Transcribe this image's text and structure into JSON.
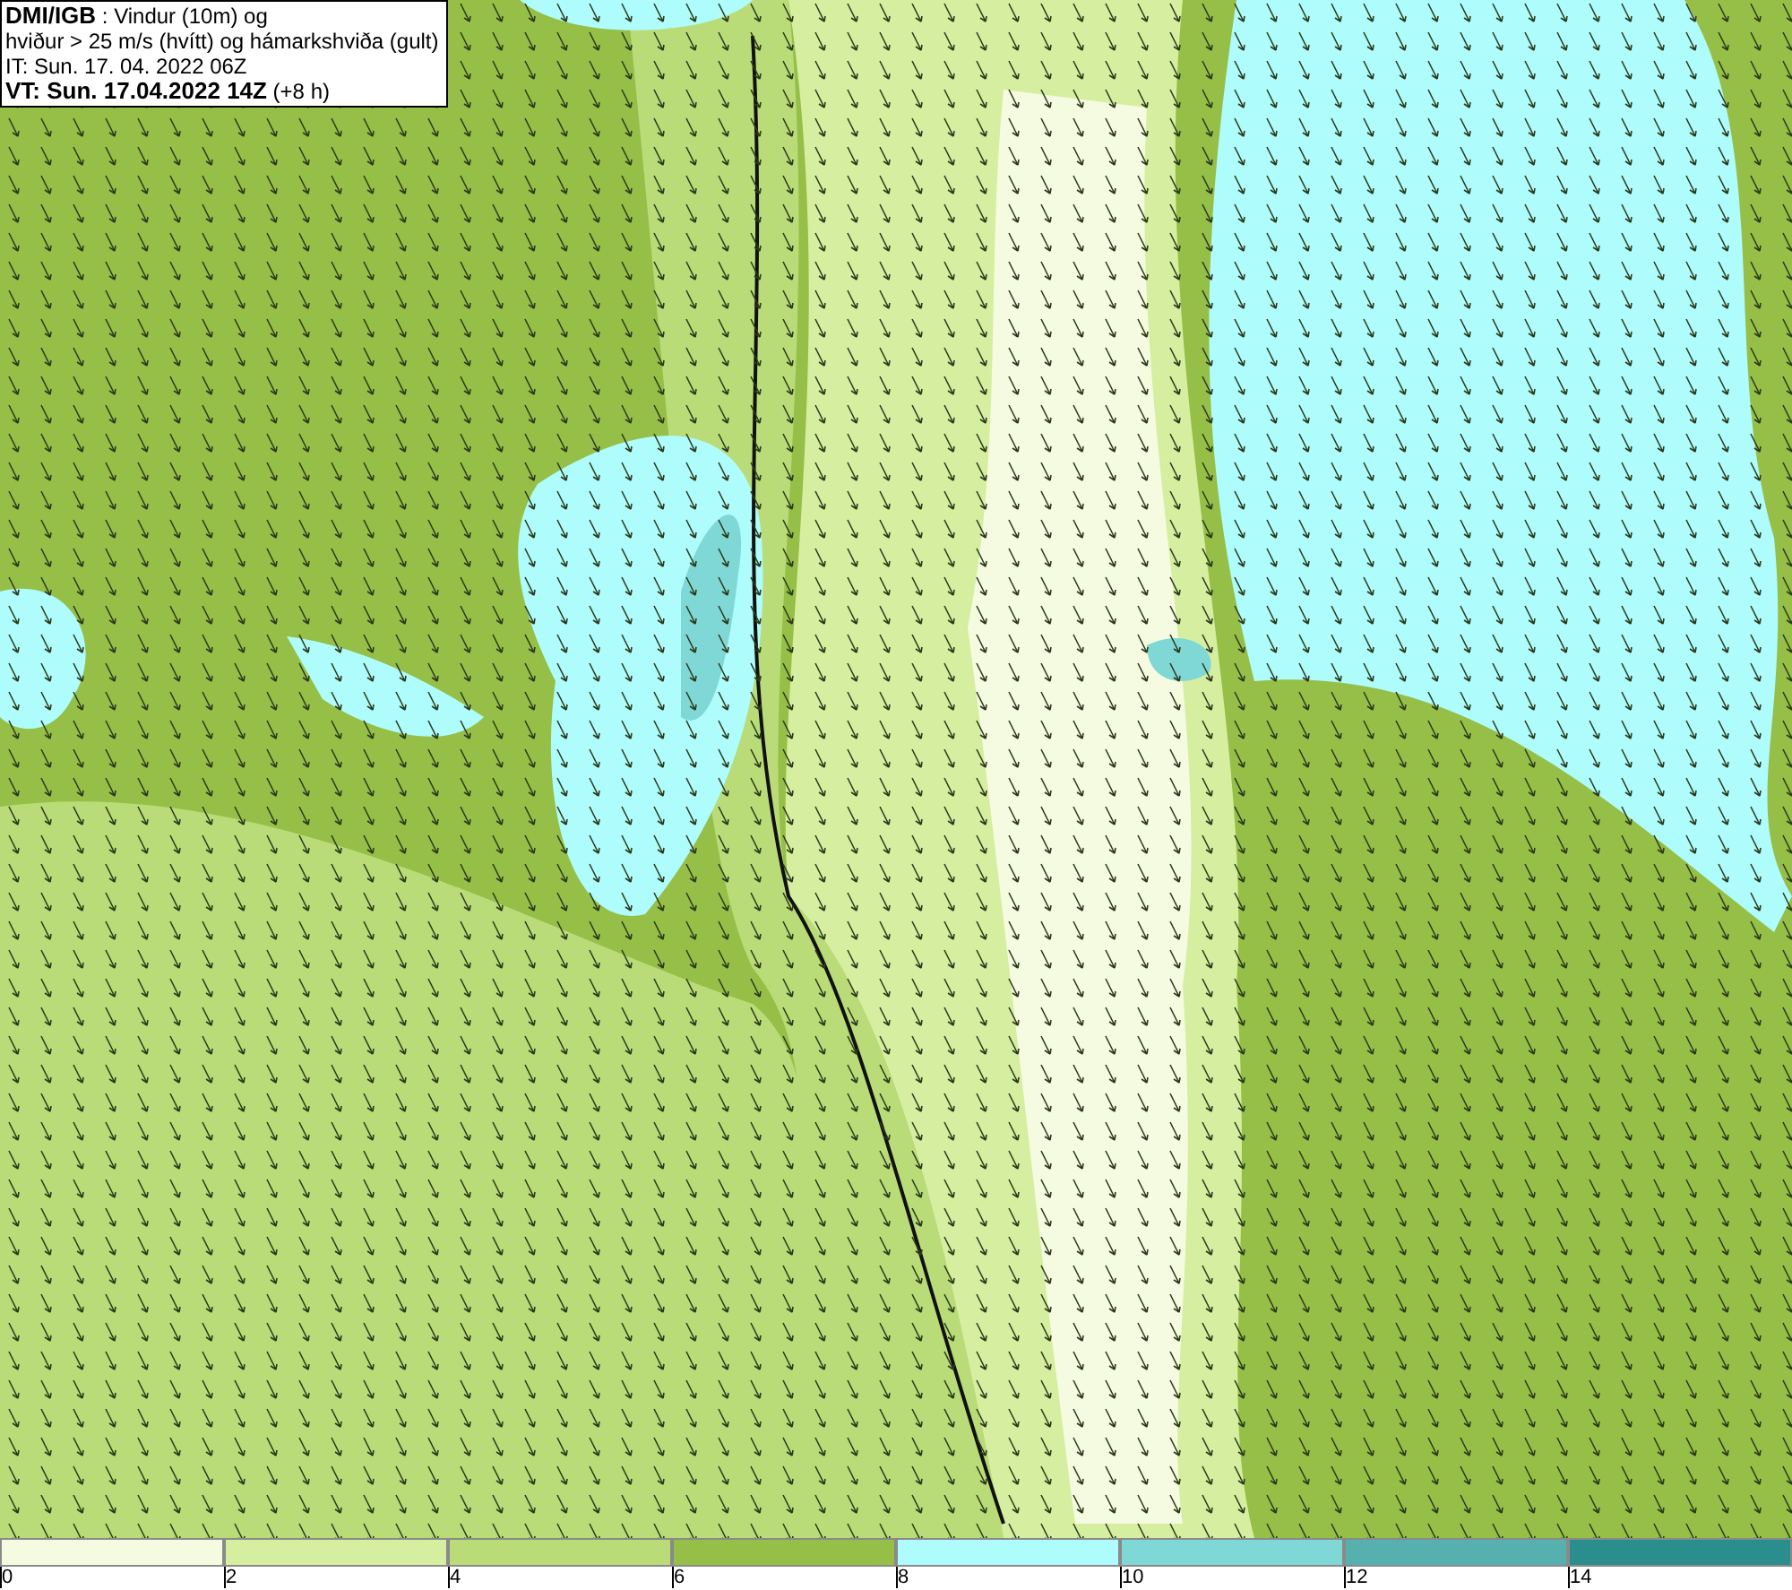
{
  "header": {
    "lines": [
      "**DMI/IGB** : Vindur (10m) og",
      "hviður > 25 m/s (hvítt) og hámarkshviða (gult)",
      "IT: Sun. 17. 04. 2022 06Z",
      "**VT: Sun. 17.04.2022 14Z** (+8 h)"
    ]
  },
  "legend": {
    "bins": [
      {
        "color": "#f5fbe0",
        "label": "0"
      },
      {
        "color": "#d6eea0",
        "label": "2"
      },
      {
        "color": "#b9dc78",
        "label": "4"
      },
      {
        "color": "#96bf48",
        "label": "6"
      },
      {
        "color": "#aefcfc",
        "label": "8"
      },
      {
        "color": "#7fd8d6",
        "label": "10"
      },
      {
        "color": "#55b0ae",
        "label": "12"
      },
      {
        "color": "#2a8f8c",
        "label": "14"
      }
    ]
  }
}
